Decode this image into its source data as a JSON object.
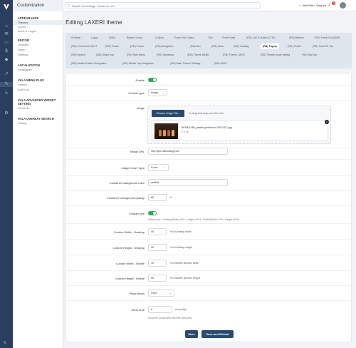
{
  "rail": {
    "icons": [
      "logo-icon",
      "home-icon",
      "chat-icon",
      "folder-icon",
      "dollar-icon",
      "tag-icon",
      "chart-icon",
      "brush-icon",
      "user-icon",
      "settings-icon"
    ],
    "bottom_icon": "menu-icon"
  },
  "sidebar": {
    "header": "Customization",
    "sections": [
      {
        "title": "APPEARANCE",
        "items": [
          "Themes",
          "Levels",
          "Icons & Logos"
        ]
      },
      {
        "title": "EDITOR",
        "items": [
          "Toolbars",
          "Setup",
          "Settings"
        ]
      },
      {
        "title": "LOCALIZATION",
        "items": [
          "Languages"
        ]
      },
      {
        "title": "VALA MENU PLUS",
        "items": [
          "Setting",
          "Add Icon"
        ]
      },
      {
        "title": "VALA ADVANCED WIDGET SETTING",
        "items": [
          "Contents"
        ]
      },
      {
        "title": "VALA OVERLAY SEARCH",
        "items": [
          "Setting"
        ]
      }
    ]
  },
  "topbar": {
    "search_placeholder": "Search for settings, members, etc",
    "visit_site": "Visit Site",
    "support": "Support",
    "notification_count": "5"
  },
  "page": {
    "title": "Editing LAXERI theme"
  },
  "tabs": [
    [
      "General",
      "Logos",
      "Editor",
      "Button Colors",
      "Custom",
      "Front-End Colors",
      "Text",
      "Front Scale",
      "(RD) Call To Action (CTA)",
      "(RD) Buttons",
      "(RD) Front-End DARK"
    ],
    [
      "(RD) Front-End LIGHT",
      "(RD) Footer",
      "(RD) Forum",
      "(RD) Navigation",
      "(RD) Box",
      "(RD) Links",
      "(RD) Loading",
      "(RD) Popup",
      "(RD) Profile",
      "(RD) Scroll To Top"
    ],
    [
      "(RD) Search",
      "(RD) Share Bar",
      "(RD) Side Menu",
      "(RD) Sideshow",
      "(RD) Theme DARK",
      "(RD) Theme LIGHT",
      "(RD) Theme mode setting",
      "(RD) Top Bar"
    ],
    [
      "(RD) Mobile Bottom Navigation",
      "(RD) Mobile Top Navigation",
      "(RD) Main Theme Settings",
      "(RD) MISC"
    ]
  ],
  "active_tab": "(RD) Popup",
  "form": {
    "enable": {
      "label": "Enable",
      "on": true
    },
    "content_type": {
      "label": "Content type",
      "value": "Image"
    },
    "image": {
      "label": "Image",
      "button": "Choose Image File...",
      "hint": "Or drag and drop your file here",
      "file_name": "1976811480_pexels-yuraforrat-20972417.jpg",
      "file_size": "17.5 kB",
      "remove": "×"
    },
    "image_url": {
      "label": "Image URL",
      "value": "http://qrs.valecoding.com"
    },
    "image_cover_type": {
      "label": "Image Cover Type",
      "value": "Cover"
    },
    "bg_color": {
      "label": "Container background color",
      "value": "ae8fe8"
    },
    "bg_opacity": {
      "label": "Container background opacity",
      "value": "80",
      "suffix": "%"
    },
    "custom_size": {
      "label": "Custom size",
      "on": true,
      "hint": "Default size : Desktop(Width=40% , Height=40%) , Mobile(Width=75% , Height=40%)"
    },
    "width_desktop": {
      "label": "Custom Width - Desktop",
      "value": "40",
      "suffix": "% of Desktop width"
    },
    "height_desktop": {
      "label": "Custom Height - Desktop",
      "value": "40",
      "suffix": "% of Desktop height"
    },
    "width_mobile": {
      "label": "Custom Width - Mobile",
      "value": "75",
      "suffix": "% of Mobile devices width"
    },
    "height_mobile": {
      "label": "Custom Height - Mobile",
      "value": "55",
      "suffix": "% of Mobile devices height"
    },
    "show_status": {
      "label": "Show status",
      "value": "Once"
    },
    "show_time": {
      "label": "Show time",
      "value": "5",
      "suffix": "second(s)",
      "hint": "Show the popup after this time (seconds)"
    }
  },
  "actions": {
    "save": "Save",
    "save_reload": "Save and Reload"
  },
  "colors": {
    "rail": "#2a3f5b",
    "primary": "#2b4a6f",
    "toggle_on": "#35a853",
    "badge": "#e53935"
  }
}
